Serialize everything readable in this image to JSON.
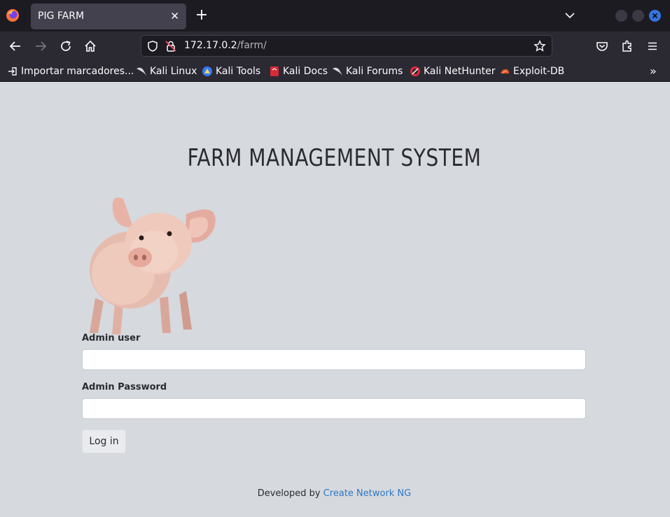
{
  "browser": {
    "tab_title": "PIG FARM",
    "tab_close": "✕",
    "new_tab": "+",
    "url_host": "172.17.0.2",
    "url_path": "/farm/"
  },
  "bookmarks": [
    {
      "label": "Importar marcadores...",
      "icon": "import-icon"
    },
    {
      "label": "Kali Linux",
      "icon": "kali-dragon-icon"
    },
    {
      "label": "Kali Tools",
      "icon": "kali-tools-icon"
    },
    {
      "label": "Kali Docs",
      "icon": "kali-docs-icon"
    },
    {
      "label": "Kali Forums",
      "icon": "kali-dragon-icon"
    },
    {
      "label": "Kali NetHunter",
      "icon": "nethunter-icon"
    },
    {
      "label": "Exploit-DB",
      "icon": "exploit-db-icon"
    }
  ],
  "page": {
    "heading": "FARM MANAGEMENT SYSTEM",
    "user_label": "Admin user",
    "user_value": "",
    "password_label": "Admin Password",
    "password_value": "",
    "login_button": "Log in",
    "footer_prefix": "Developed by ",
    "footer_link": "Create Network NG"
  },
  "colors": {
    "page_bg": "#d6d9de",
    "link": "#2f78c4",
    "chrome_dark": "#1c1b22",
    "chrome": "#2b2a33"
  }
}
